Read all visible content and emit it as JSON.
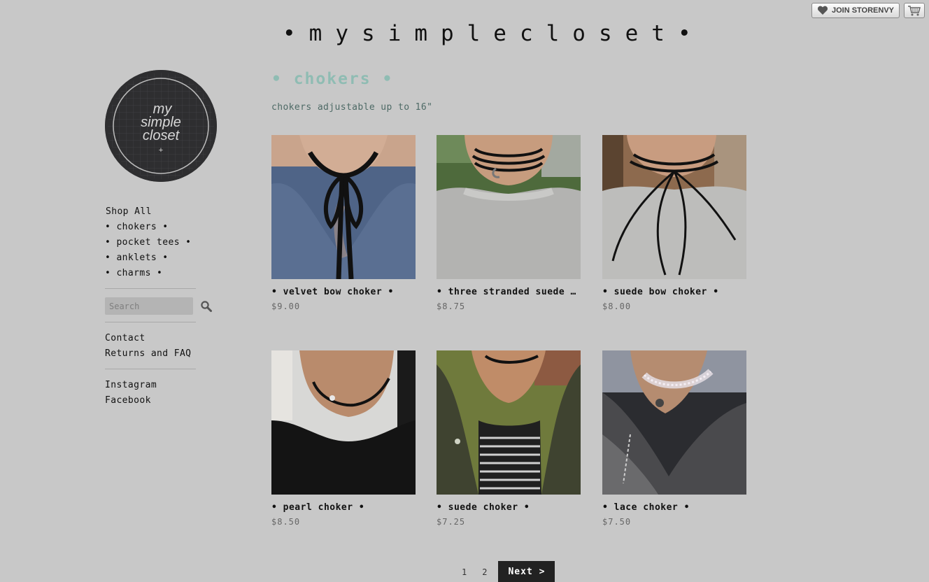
{
  "topbar": {
    "join_label": "JOIN STORENVY",
    "join_icon": "heart-icon",
    "cart_icon": "cart-icon"
  },
  "store": {
    "title": "•mysimplecloset•",
    "logo_text": [
      "my",
      "simple",
      "closet",
      "+"
    ]
  },
  "sidebar": {
    "nav": [
      {
        "label": "Shop All"
      },
      {
        "label": "• chokers •"
      },
      {
        "label": "• pocket tees •"
      },
      {
        "label": "• anklets •"
      },
      {
        "label": "• charms •"
      }
    ],
    "search": {
      "placeholder": "Search",
      "icon": "search-icon"
    },
    "info_links": [
      {
        "label": "Contact"
      },
      {
        "label": "Returns and FAQ"
      }
    ],
    "social_links": [
      {
        "label": "Instagram"
      },
      {
        "label": "Facebook"
      }
    ]
  },
  "category": {
    "title": "• chokers •",
    "description": "chokers adjustable up to 16\""
  },
  "products": [
    {
      "name": "• velvet bow choker •",
      "price": "$9.00"
    },
    {
      "name": "• three stranded suede choker •",
      "price": "$8.75"
    },
    {
      "name": "• suede bow choker •",
      "price": "$8.00"
    },
    {
      "name": "• pearl choker •",
      "price": "$8.50"
    },
    {
      "name": "• suede choker •",
      "price": "$7.25"
    },
    {
      "name": "• lace choker •",
      "price": "$7.50"
    }
  ],
  "pagination": {
    "pages": [
      "1",
      "2"
    ],
    "next_label": "Next >"
  }
}
